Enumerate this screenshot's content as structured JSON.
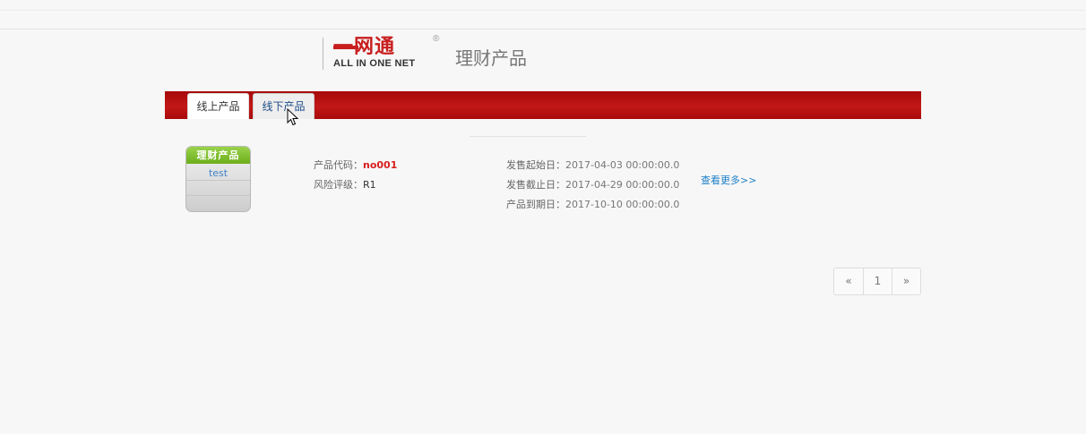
{
  "header": {
    "brand_cn": "一网通",
    "brand_en": "ALL IN ONE NET",
    "reg_mark": "®",
    "page_title": "理财产品"
  },
  "tabs": [
    {
      "label": "线上产品",
      "active": true
    },
    {
      "label": "线下产品",
      "active": false
    }
  ],
  "product": {
    "badge_title": "理财产品",
    "badge_name": "test",
    "code_label": "产品代码：",
    "code_value": "no001",
    "risk_label": "风险评级：",
    "risk_value": "R1",
    "sale_start_label": "发售起始日：",
    "sale_start_value": "2017-04-03 00:00:00.0",
    "sale_end_label": "发售截止日：",
    "sale_end_value": "2017-04-29 00:00:00.0",
    "maturity_label": "产品到期日：",
    "maturity_value": "2017-10-10 00:00:00.0",
    "more_link": "查看更多>>"
  },
  "pagination": {
    "prev": "«",
    "current": "1",
    "next": "»"
  },
  "colors": {
    "brand_red": "#c31717",
    "badge_green": "#7cbf2a",
    "link_blue": "#1d7fc8"
  }
}
